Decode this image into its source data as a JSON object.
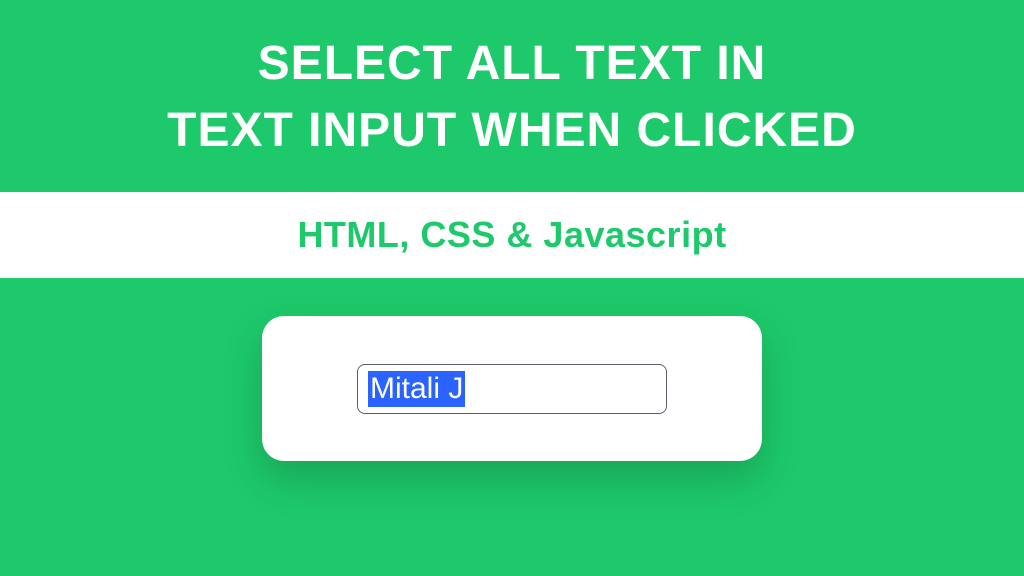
{
  "header": {
    "title_line1": "SELECT ALL TEXT IN",
    "title_line2": "TEXT INPUT WHEN CLICKED"
  },
  "subtitle_band": {
    "label": "HTML, CSS & Javascript"
  },
  "demo": {
    "input_value": "Mitali J"
  },
  "colors": {
    "background": "#1dc96a",
    "accent": "#2a63ff",
    "card": "#ffffff"
  }
}
